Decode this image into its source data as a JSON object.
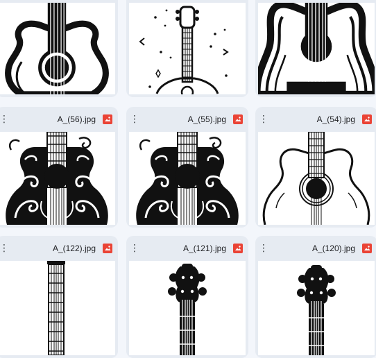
{
  "grid": {
    "rows": [
      {
        "cards": [
          {
            "filename": "",
            "thumbnail": "guitar-body-front",
            "icon": "image-file-icon"
          },
          {
            "filename": "",
            "thumbnail": "guitar-with-sparkles",
            "icon": "image-file-icon"
          },
          {
            "filename": "",
            "thumbnail": "guitar-body-closeup",
            "icon": "image-file-icon"
          }
        ]
      },
      {
        "cards": [
          {
            "filename": "A_(56).jpg",
            "thumbnail": "ornate-swirl-guitar",
            "icon": "image-file-icon"
          },
          {
            "filename": "A_(55).jpg",
            "thumbnail": "ornate-swirl-guitar",
            "icon": "image-file-icon"
          },
          {
            "filename": "A_(54).jpg",
            "thumbnail": "acoustic-guitar-outline",
            "icon": "image-file-icon"
          }
        ]
      },
      {
        "cards": [
          {
            "filename": "A_(122).jpg",
            "thumbnail": "guitar-neck",
            "icon": "image-file-icon"
          },
          {
            "filename": "A_(121).jpg",
            "thumbnail": "guitar-headstock",
            "icon": "image-file-icon"
          },
          {
            "filename": "A_(120).jpg",
            "thumbnail": "guitar-headstock",
            "icon": "image-file-icon"
          }
        ]
      }
    ]
  },
  "colors": {
    "page_bg": "#f3f6fb",
    "card_bg": "#e6ebf2",
    "image_icon": "#ea4335"
  },
  "menu_glyph": "⋮"
}
